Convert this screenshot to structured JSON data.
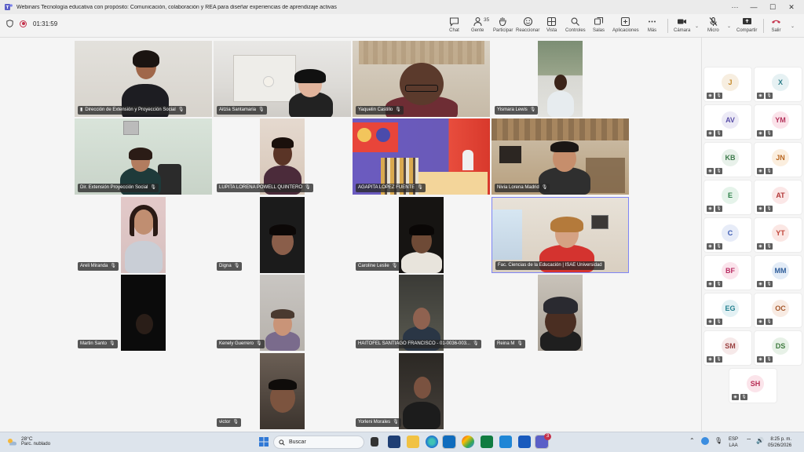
{
  "window": {
    "title": "Webinars Tecnología educativa con propósito: Comunicación, colaboración y REA para diseñar experiencias de aprendizaje activas",
    "minimize": "—",
    "maximize": "☐",
    "close": "✕",
    "more": "···"
  },
  "toolbar": {
    "timer": "01:31:59",
    "chat": "Chat",
    "people": "Gente",
    "people_count": "35",
    "raise": "Participar",
    "react": "Reaccionar",
    "view": "Vista",
    "controls": "Controles",
    "rooms": "Salas",
    "apps": "Aplicaciones",
    "more": "Más",
    "camera": "Cámara",
    "mic": "Micro",
    "share": "Compartir",
    "leave": "Salir",
    "colors": {
      "leave": "#c4314b",
      "accent": "#5b5fc7"
    }
  },
  "participants": [
    {
      "name": "Dirección de Extensión y Proyección Social"
    },
    {
      "name": "Aitzia Santamaria"
    },
    {
      "name": "Yaquelin Castillo"
    },
    {
      "name": "Yismara Lewis"
    },
    {
      "name": "Dir. Extensión Proyección Social"
    },
    {
      "name": "LUPITA LORENA POWELL QUINTERO"
    },
    {
      "name": "AGAPITA LOPEZ FUENTE"
    },
    {
      "name": "Nivia Lorena Madrid"
    },
    {
      "name": "Areli Miranda"
    },
    {
      "name": "Digna"
    },
    {
      "name": "Caroline Leslie"
    },
    {
      "name": "Fac. Ciencias de la Educación | ISAE Universidad"
    },
    {
      "name": "Martin Santo"
    },
    {
      "name": "Kenely Guerrero"
    },
    {
      "name": "HAITOFEL SANTIAGO FRANCISCO - 01-0036-003..."
    },
    {
      "name": "Reina M"
    },
    {
      "name": "victor"
    },
    {
      "name": "Yorleni Morales"
    }
  ],
  "roster": [
    {
      "initials": "J",
      "bg": "#f7eee0",
      "fg": "#c58a2b"
    },
    {
      "initials": "X",
      "bg": "#e6f1f3",
      "fg": "#2f7f8a"
    },
    {
      "initials": "AV",
      "bg": "#eceaf6",
      "fg": "#5a4fa8"
    },
    {
      "initials": "YM",
      "bg": "#fbe3ea",
      "fg": "#b2315a"
    },
    {
      "initials": "KB",
      "bg": "#e8f1ea",
      "fg": "#3e7a4c"
    },
    {
      "initials": "JN",
      "bg": "#fbeede",
      "fg": "#b8651f"
    },
    {
      "initials": "E",
      "bg": "#e5f3ea",
      "fg": "#2e8049"
    },
    {
      "initials": "AT",
      "bg": "#fbe7e7",
      "fg": "#b23737"
    },
    {
      "initials": "C",
      "bg": "#e7ecf8",
      "fg": "#3c5bb3"
    },
    {
      "initials": "YT",
      "bg": "#fbe7e4",
      "fg": "#c0463a"
    },
    {
      "initials": "BF",
      "bg": "#fbe4ec",
      "fg": "#b72d62"
    },
    {
      "initials": "MM",
      "bg": "#e3ecf7",
      "fg": "#2e5d9a"
    },
    {
      "initials": "EG",
      "bg": "#e3f1f4",
      "fg": "#23808f"
    },
    {
      "initials": "OC",
      "bg": "#f8ebe3",
      "fg": "#a4572b"
    },
    {
      "initials": "SM",
      "bg": "#f6e9e9",
      "fg": "#9a4040"
    },
    {
      "initials": "DS",
      "bg": "#e7f1e7",
      "fg": "#3e7a3e"
    },
    {
      "initials": "SH",
      "bg": "#fbe4ea",
      "fg": "#b72d54"
    }
  ],
  "taskbar": {
    "temp": "28°C",
    "weather": "Parc. nublado",
    "search": "Buscar",
    "lang1": "ESP",
    "lang2": "LAA",
    "time": "8:25 p. m.",
    "date": "05/26/2026",
    "badge": "3"
  }
}
